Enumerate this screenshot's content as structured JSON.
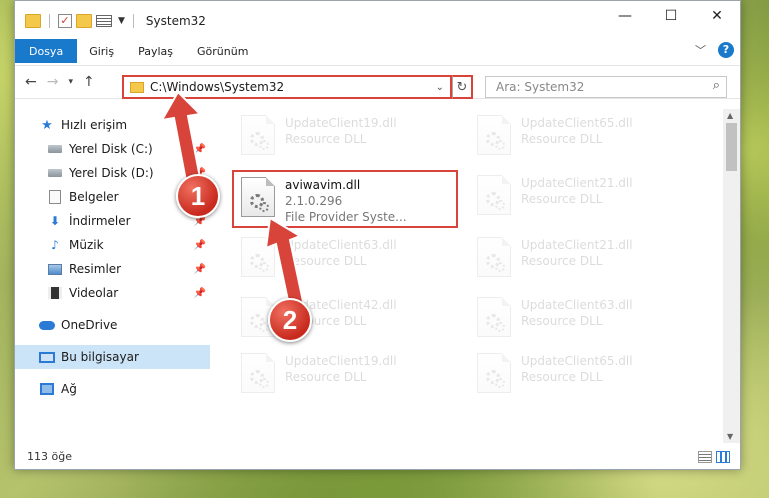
{
  "window": {
    "title": "System32"
  },
  "titlebar": {
    "minimize": "—",
    "maximize": "☐",
    "close": "✕"
  },
  "ribbon": {
    "tabs": [
      "Dosya",
      "Giriş",
      "Paylaş",
      "Görünüm"
    ],
    "help": "?"
  },
  "address": {
    "path": "C:\\Windows\\System32"
  },
  "search": {
    "placeholder": "Ara: System32"
  },
  "sidebar": {
    "items": [
      {
        "label": "Hızlı erişim"
      },
      {
        "label": "Yerel Disk (C:)"
      },
      {
        "label": "Yerel Disk (D:)"
      },
      {
        "label": "Belgeler"
      },
      {
        "label": "İndirmeler"
      },
      {
        "label": "Müzik"
      },
      {
        "label": "Resimler"
      },
      {
        "label": "Videolar"
      },
      {
        "label": "OneDrive"
      },
      {
        "label": "Bu bilgisayar"
      },
      {
        "label": "Ağ"
      }
    ]
  },
  "files": {
    "highlighted": {
      "name": "aviwavim.dll",
      "version": "2.1.0.296",
      "description": "File Provider Syste..."
    },
    "background": [
      {
        "name": "UpdateClient19.dll",
        "sub": "Resource DLL"
      },
      {
        "name": "UpdateClient65.dll",
        "sub": "Resource DLL"
      },
      {
        "name": "UpdateClient21.dll",
        "sub": "Resource DLL"
      },
      {
        "name": "UpdateClient63.dll",
        "sub": "Resource DLL"
      },
      {
        "name": "UpdateClient21.dll",
        "sub": "Resource DLL"
      },
      {
        "name": "UpdateClient42.dll",
        "sub": "Resource DLL"
      },
      {
        "name": "UpdateClient63.dll",
        "sub": "Resource DLL"
      },
      {
        "name": "UpdateClient19.dll",
        "sub": "Resource DLL"
      },
      {
        "name": "UpdateClient65.dll",
        "sub": "Resource DLL"
      }
    ]
  },
  "status": {
    "count": "113 öğe"
  },
  "annotations": {
    "step1": "1",
    "step2": "2"
  },
  "colors": {
    "accent": "#1979ca",
    "highlight": "#d9443a",
    "selection": "#cce4f7"
  }
}
